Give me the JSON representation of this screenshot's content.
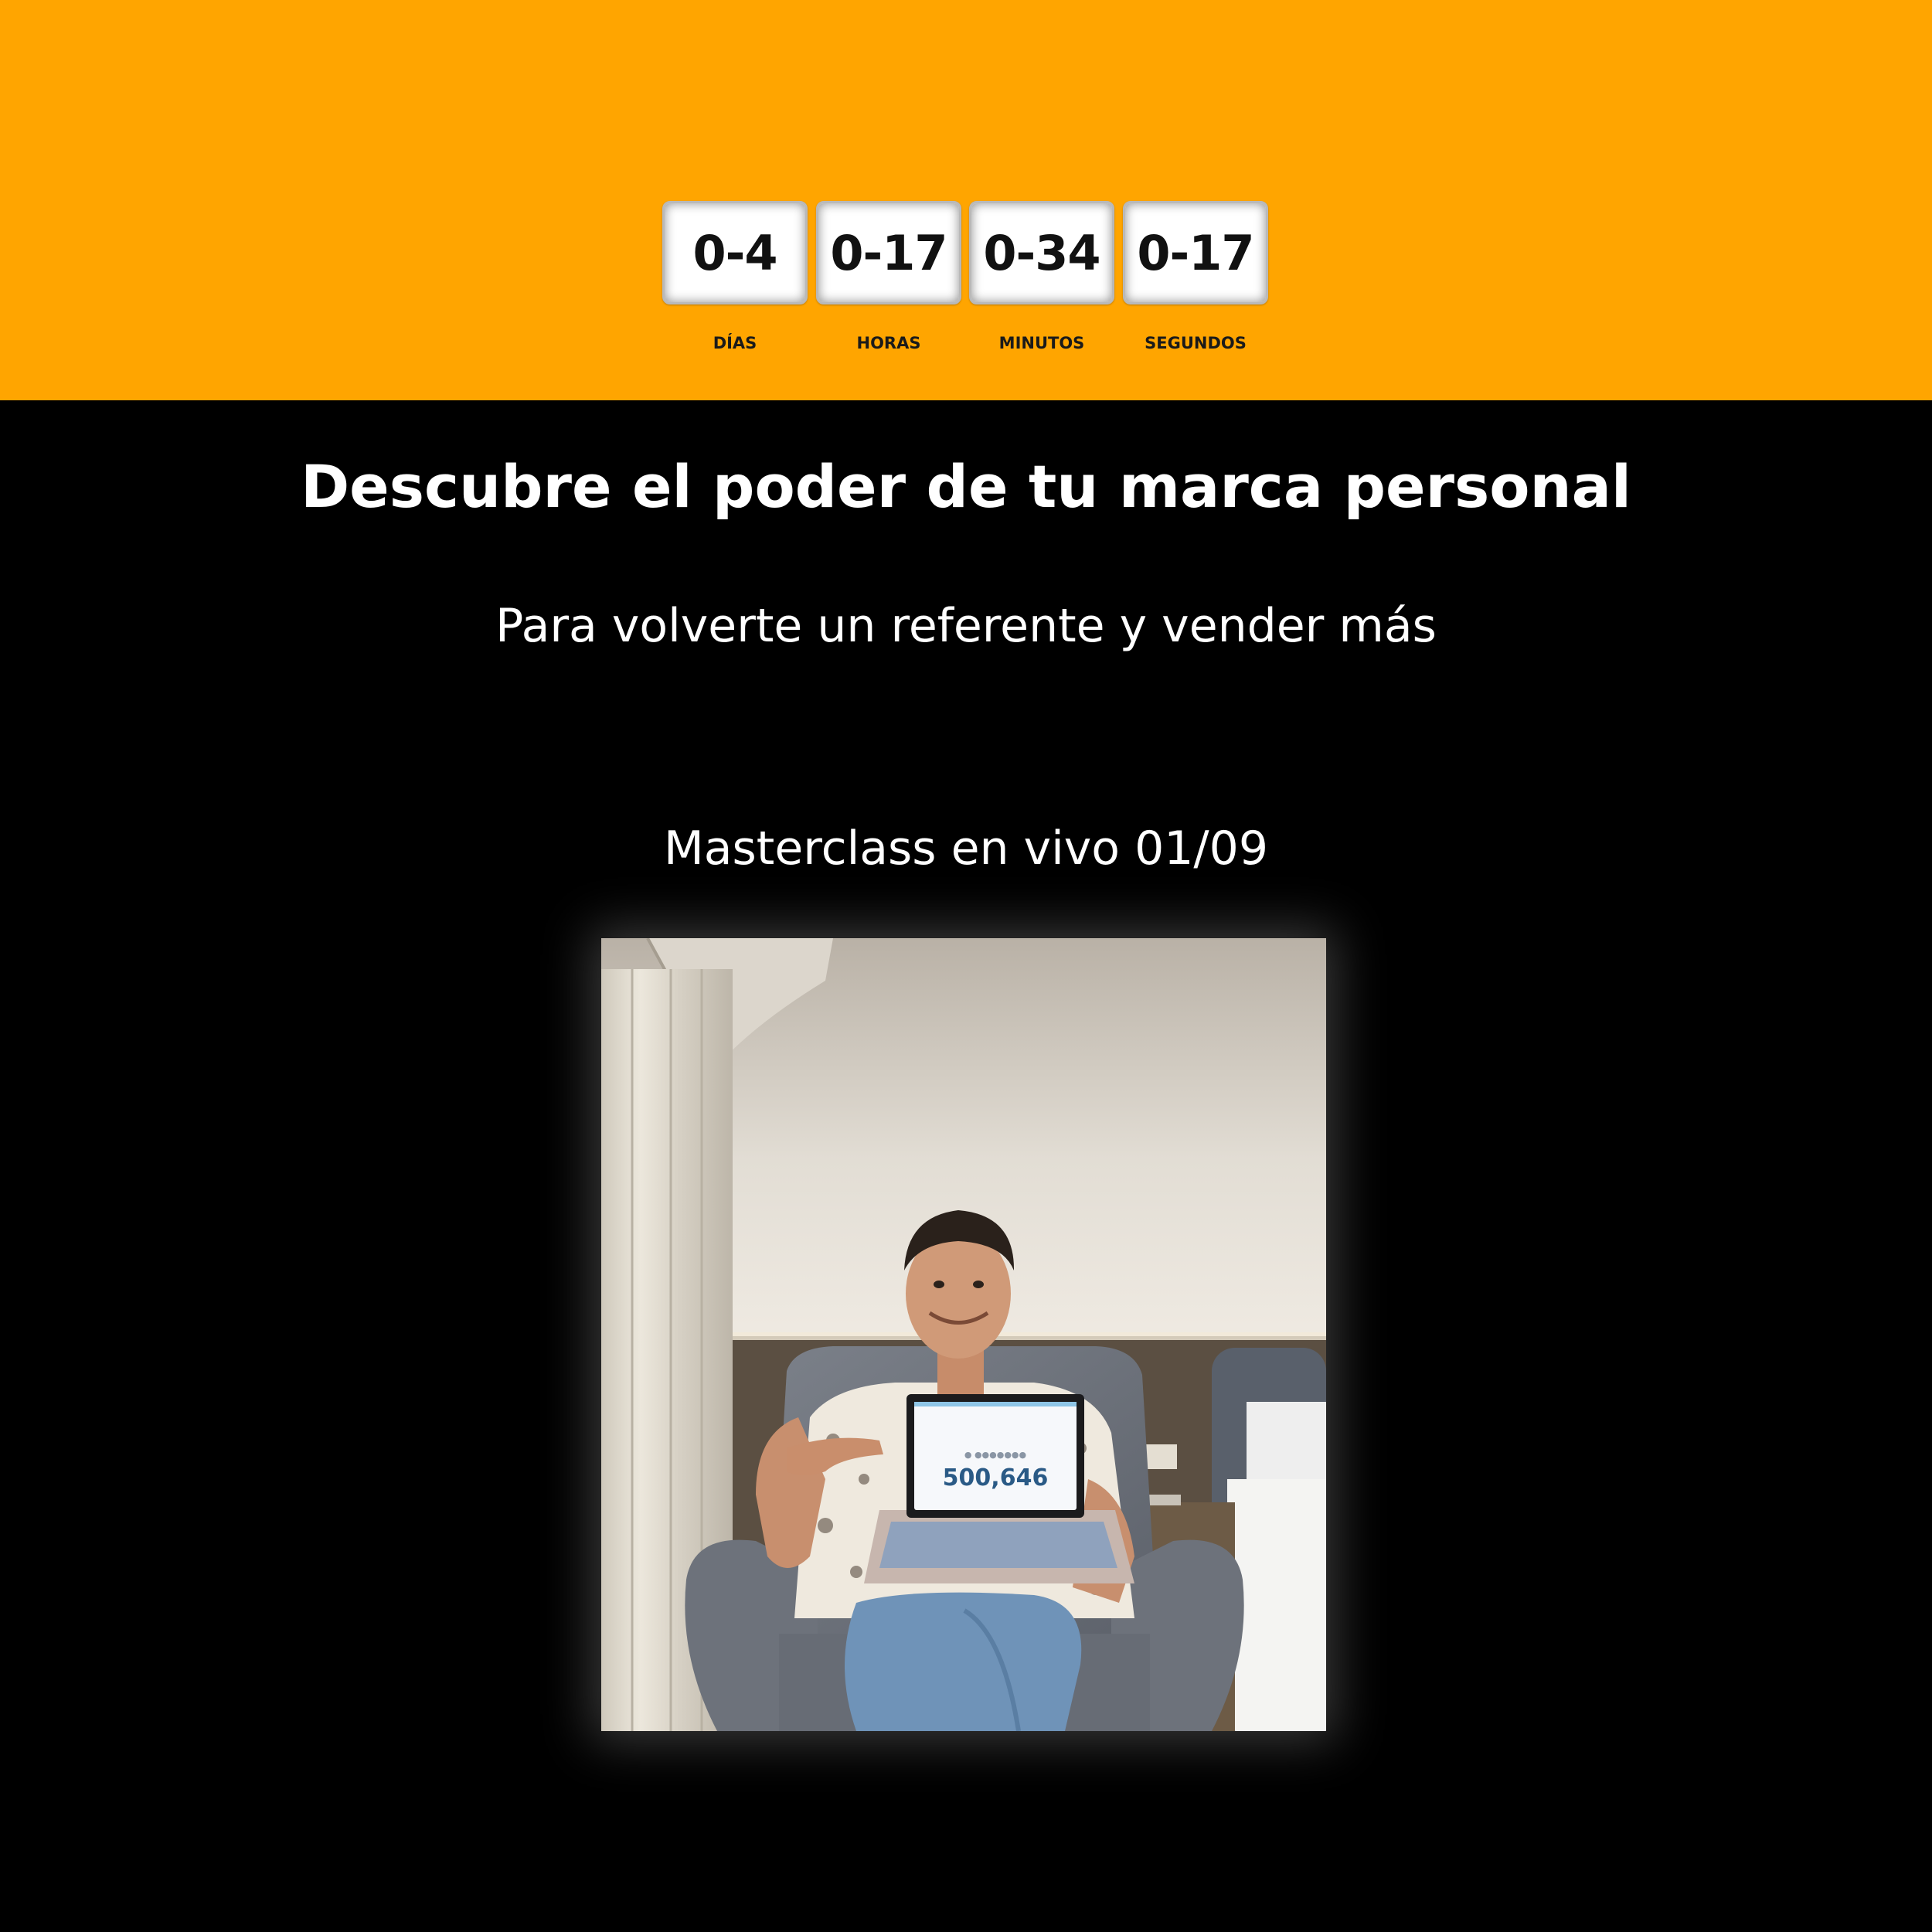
{
  "countdown": {
    "units": [
      {
        "value": "0-4",
        "label": "DÍAS"
      },
      {
        "value": "0-17",
        "label": "HORAS"
      },
      {
        "value": "0-34",
        "label": "MINUTOS"
      },
      {
        "value": "0-17",
        "label": "SEGUNDOS"
      }
    ]
  },
  "hero": {
    "title": "Descubre el poder de tu marca personal",
    "subtitle": "Para volverte un referente y vender más",
    "event": "Masterclass en vivo 01/09"
  },
  "photo": {
    "laptop_number": "500,646"
  },
  "colors": {
    "band": "#FFA500",
    "background": "#000000",
    "text": "#FFFFFF"
  }
}
